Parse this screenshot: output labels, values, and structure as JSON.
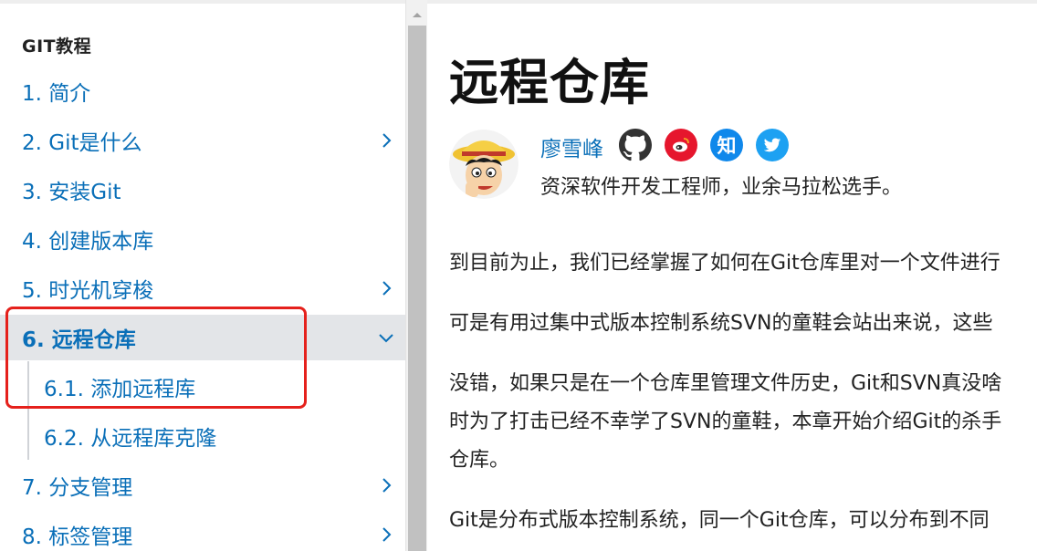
{
  "sidebar": {
    "title": "GIT教程",
    "items": [
      {
        "label": "1. 简介",
        "chevron": ""
      },
      {
        "label": "2. Git是什么",
        "chevron": "chevron-right"
      },
      {
        "label": "3. 安装Git",
        "chevron": ""
      },
      {
        "label": "4. 创建版本库",
        "chevron": ""
      },
      {
        "label": "5. 时光机穿梭",
        "chevron": "chevron-right"
      },
      {
        "label": "6. 远程仓库",
        "chevron": "chevron-down",
        "active": true
      },
      {
        "label": "6.1. 添加远程库",
        "level": 2
      },
      {
        "label": "6.2. 从远程库克隆",
        "level": 2
      },
      {
        "label": "7. 分支管理",
        "chevron": "chevron-right"
      },
      {
        "label": "8. 标签管理",
        "chevron": "chevron-right"
      }
    ]
  },
  "main": {
    "title": "远程仓库",
    "author": {
      "name": "廖雪峰",
      "description": "资深软件开发工程师，业余马拉松选手。",
      "zhihu_glyph": "知"
    },
    "paragraphs": [
      "到目前为止，我们已经掌握了如何在Git仓库里对一个文件进行",
      "可是有用过集中式版本控制系统SVN的童鞋会站出来说，这些",
      "没错，如果只是在一个仓库里管理文件历史，Git和SVN真没啥",
      "时为了打击已经不幸学了SVN的童鞋，本章开始介绍Git的杀手",
      "仓库。",
      "Git是分布式版本控制系统，同一个Git仓库，可以分布到不同"
    ]
  },
  "colors": {
    "link": "#0a6fb8",
    "active_bg": "#e3e5e8",
    "highlight_box": "#e5211c",
    "weibo": "#e6162d",
    "zhihu": "#0f88eb",
    "twitter": "#1da1f2"
  }
}
